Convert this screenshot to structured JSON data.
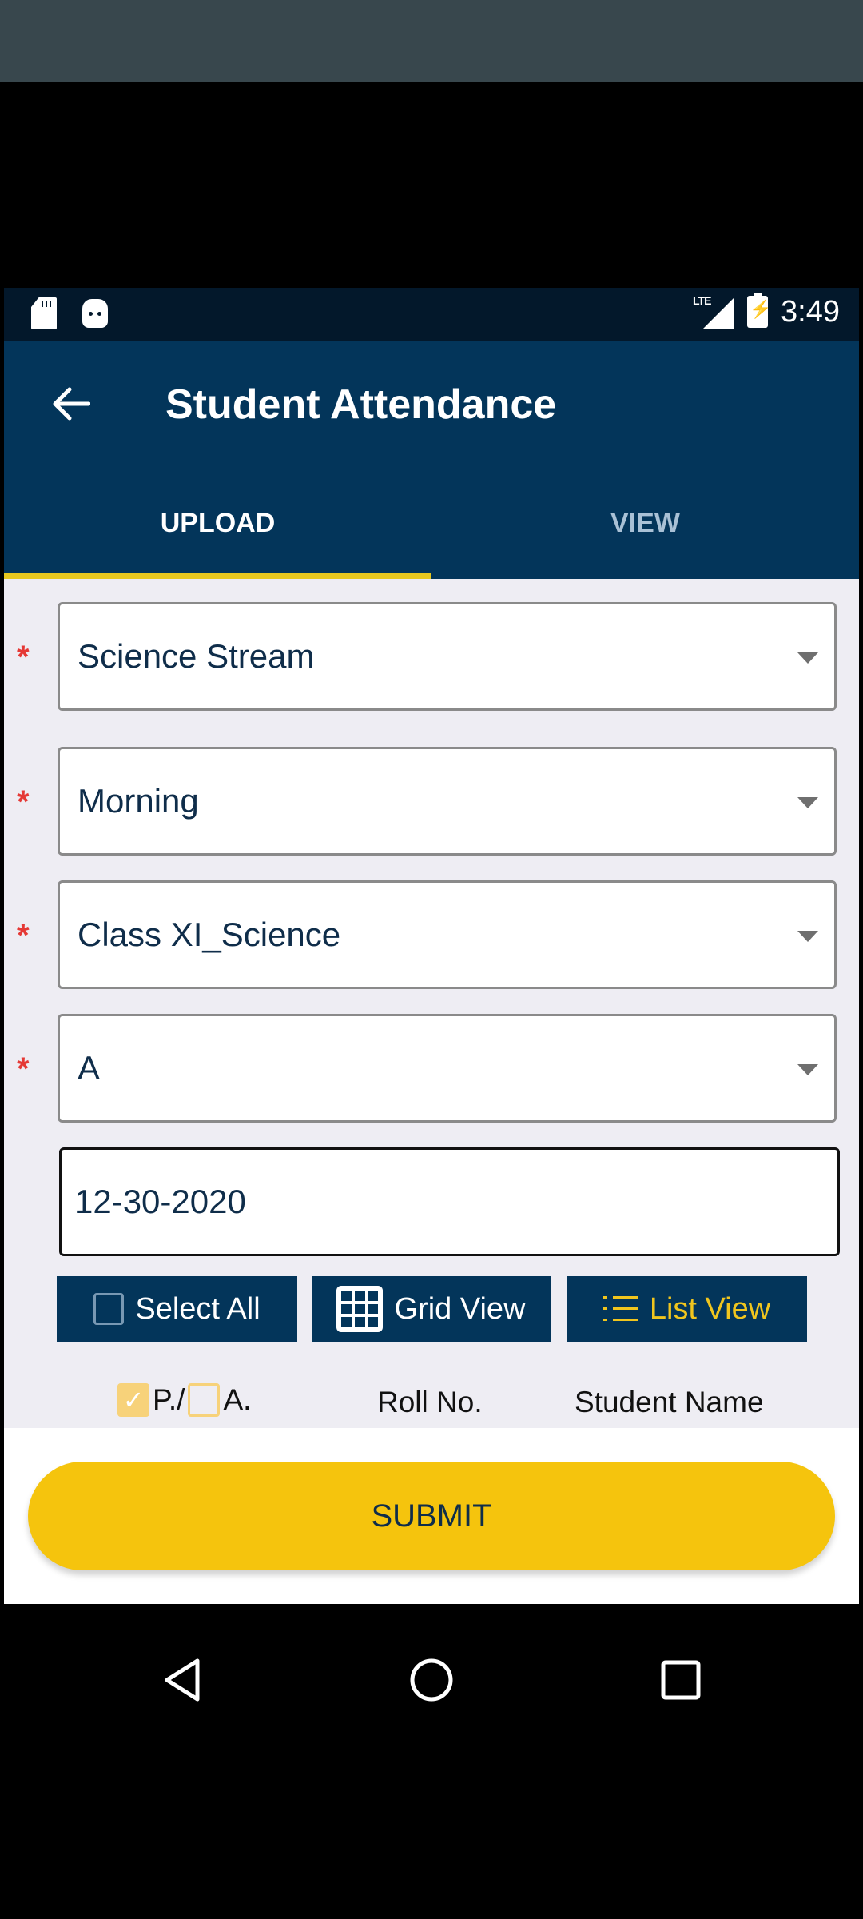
{
  "status_bar": {
    "time": "3:49",
    "network": "LTE",
    "left_icons": [
      "sd-card-icon",
      "android-debug-icon"
    ],
    "right_icons": [
      "lte-signal-icon",
      "battery-charging-icon"
    ]
  },
  "app_bar": {
    "title": "Student Attendance",
    "back_icon": "arrow-left-icon"
  },
  "tabs": [
    {
      "label": "UPLOAD",
      "active": true
    },
    {
      "label": "VIEW",
      "active": false
    }
  ],
  "form": {
    "required_marker": "*",
    "dropdowns": [
      {
        "name": "stream",
        "value": "Science Stream"
      },
      {
        "name": "shift",
        "value": "Morning"
      },
      {
        "name": "class",
        "value": "Class XI_Science"
      },
      {
        "name": "section",
        "value": "A"
      }
    ],
    "date": {
      "value": "12-30-2020"
    }
  },
  "actions": {
    "select_all": "Select All",
    "grid_view": "Grid View",
    "list_view": "List View",
    "active_view": "list"
  },
  "table_header": {
    "present": "P./",
    "absent": "A.",
    "present_check": "✓",
    "roll_no": "Roll No.",
    "student_name": "Student Name"
  },
  "footer": {
    "submit": "SUBMIT"
  },
  "colors": {
    "primary": "#03355a",
    "accent": "#f5c40d",
    "tab_indicator": "#e8c81f",
    "required": "#e53935",
    "background": "#eeedf3"
  },
  "nav_bar": [
    "back-triangle-icon",
    "home-circle-icon",
    "recents-square-icon"
  ]
}
